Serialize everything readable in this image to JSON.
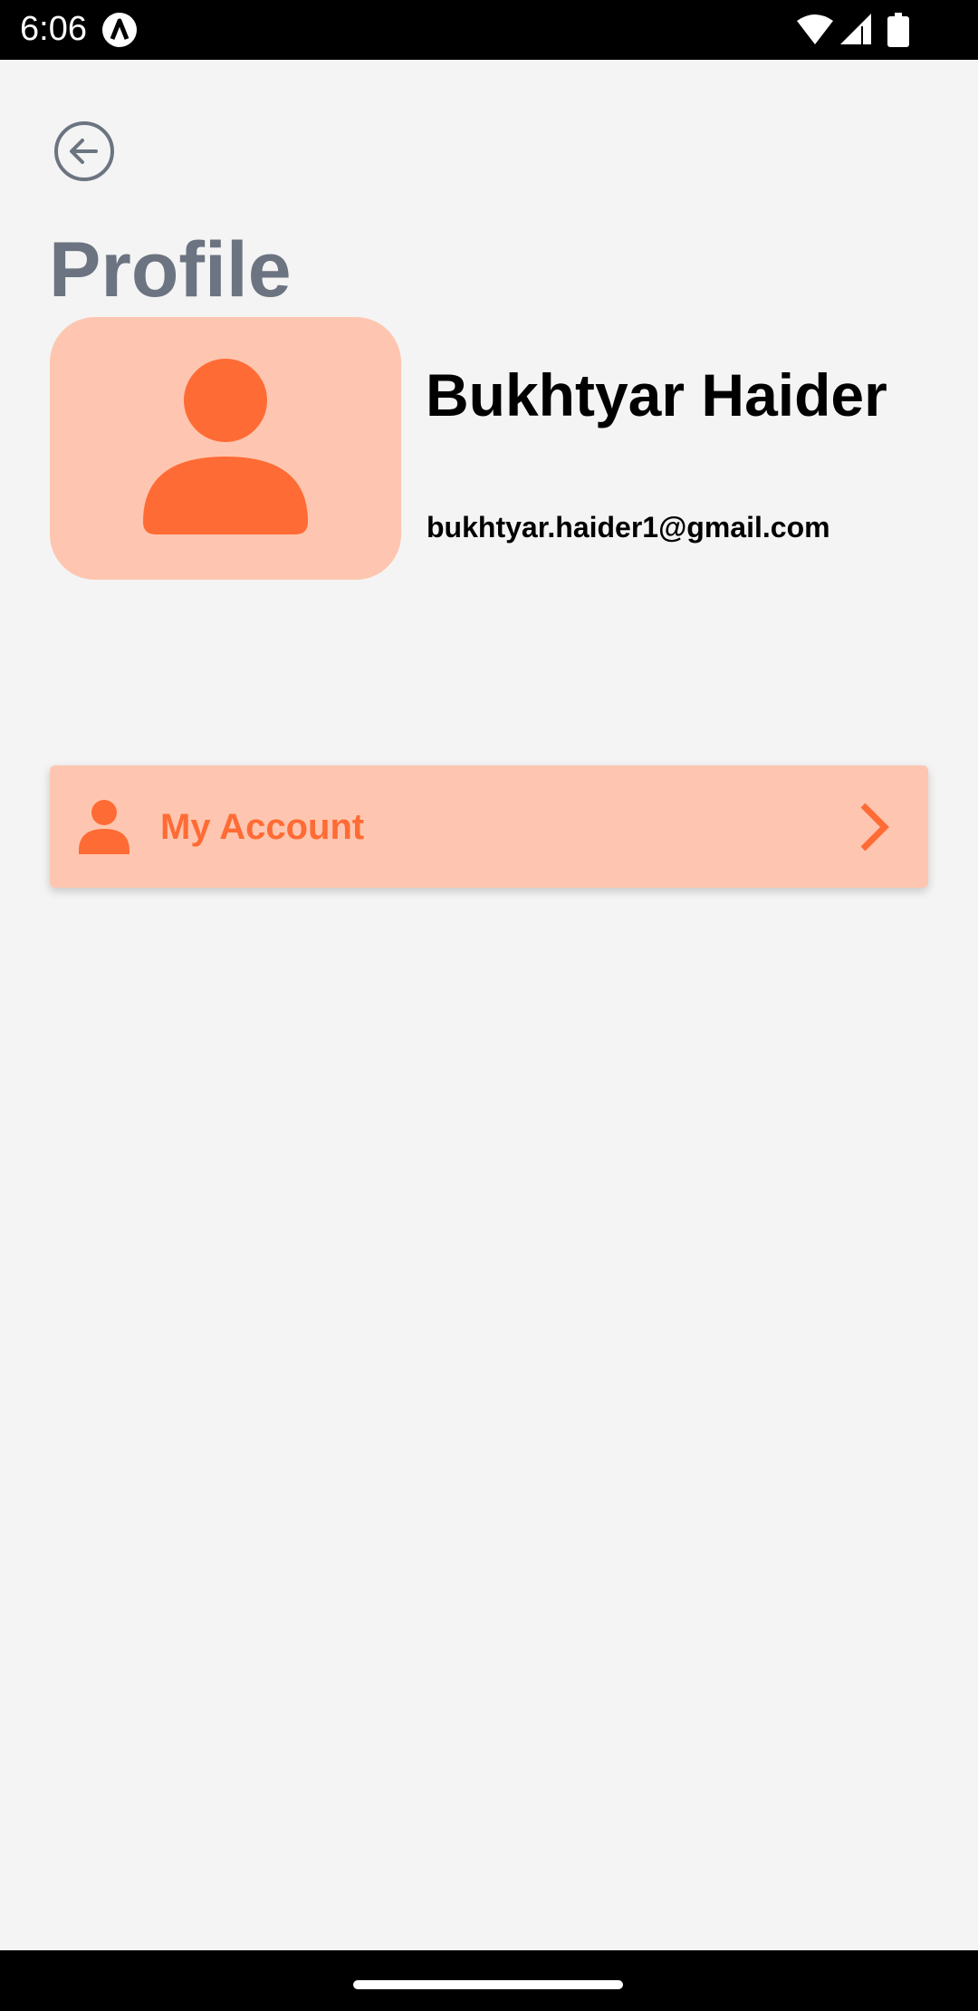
{
  "status_bar": {
    "time": "6:06",
    "app_icon": "app-notification-icon",
    "wifi_icon": "wifi-icon",
    "signal_icon": "cell-signal-icon",
    "battery_icon": "battery-icon"
  },
  "header": {
    "back_icon": "arrow-left-circle-icon",
    "title": "Profile"
  },
  "profile": {
    "avatar_icon": "user-icon",
    "name": "Bukhtyar Haider",
    "email": "bukhtyar.haider1@gmail.com"
  },
  "menu": {
    "items": [
      {
        "icon": "user-icon",
        "label": "My Account",
        "trailing_icon": "chevron-right-icon"
      }
    ]
  },
  "colors": {
    "accent": "#ff6b35",
    "accent_light": "#fec6b0",
    "title_gray": "#6b7480",
    "background": "#f4f4f4"
  }
}
